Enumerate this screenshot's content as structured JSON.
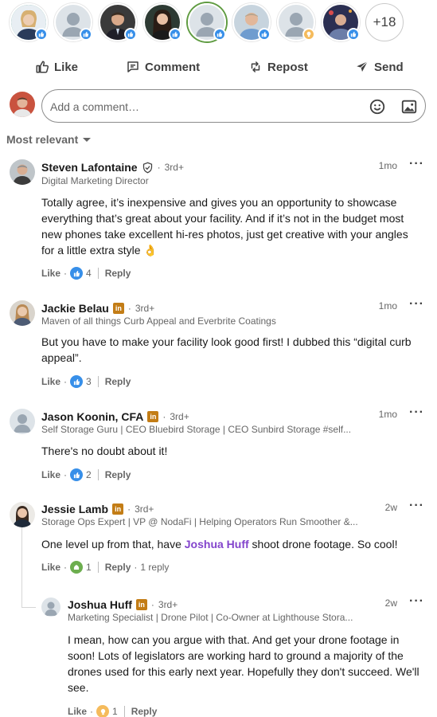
{
  "reactors": {
    "people": [
      {
        "name": "reactor-1",
        "badge": "like"
      },
      {
        "name": "reactor-2",
        "badge": "like"
      },
      {
        "name": "reactor-3",
        "badge": "like"
      },
      {
        "name": "reactor-4",
        "badge": "like"
      },
      {
        "name": "reactor-5",
        "badge": "like"
      },
      {
        "name": "reactor-6",
        "badge": "like"
      },
      {
        "name": "reactor-7",
        "badge": "insightful"
      },
      {
        "name": "reactor-8",
        "badge": "like"
      }
    ],
    "more_count": "+18"
  },
  "actions": {
    "like": "Like",
    "comment": "Comment",
    "repost": "Repost",
    "send": "Send"
  },
  "composer": {
    "placeholder": "Add a comment…"
  },
  "sort": {
    "label": "Most relevant"
  },
  "comments": [
    {
      "name": "Steven Lafontaine",
      "degree": "3rd+",
      "headline": "Digital Marketing Director",
      "time": "1mo",
      "text": "Totally agree, it’s inexpensive and gives you an opportunity to showcase everything that’s great about your facility. And if it’s not in the budget most new phones take excellent hi-res photos, just get creative with your angles for a little extra style 👌",
      "like_label": "Like",
      "reaction_count": "4",
      "reply_label": "Reply"
    },
    {
      "name": "Jackie Belau",
      "degree": "3rd+",
      "headline": "Maven of all things Curb Appeal and Everbrite Coatings",
      "time": "1mo",
      "text": "But you have to make your facility look good first! I dubbed this “digital curb appeal”.",
      "like_label": "Like",
      "reaction_count": "3",
      "reply_label": "Reply"
    },
    {
      "name": "Jason Koonin, CFA",
      "degree": "3rd+",
      "headline": "Self Storage Guru | CEO Bluebird Storage | CEO Sunbird Storage #self...",
      "time": "1mo",
      "text": "There's no doubt about it!",
      "like_label": "Like",
      "reaction_count": "2",
      "reply_label": "Reply"
    },
    {
      "name": "Jessie Lamb",
      "degree": "3rd+",
      "headline": "Storage Ops Expert | VP @ NodaFi | Helping Operators Run Smoother &...",
      "time": "2w",
      "text_before": "One level up from that, have ",
      "mention": "Joshua Huff",
      "text_after": " shoot drone footage. So cool!",
      "like_label": "Like",
      "reaction_count": "1",
      "reply_label": "Reply",
      "replies_label": "1 reply"
    },
    {
      "name": "Joshua Huff",
      "degree": "3rd+",
      "headline": "Marketing Specialist | Drone Pilot | Co-Owner at Lighthouse Stora...",
      "time": "2w",
      "text": "I mean, how can you argue with that. And get your drone footage in soon! Lots of legislators are working hard to ground a majority of the drones used for this early next year. Hopefully they don't succeed. We'll see.",
      "like_label": "Like",
      "reaction_count": "1",
      "reply_label": "Reply"
    }
  ],
  "colors": {
    "like_blue": "#378fe9",
    "mention_purple": "#8344cc",
    "linkedin_badge": "#c37d16"
  }
}
